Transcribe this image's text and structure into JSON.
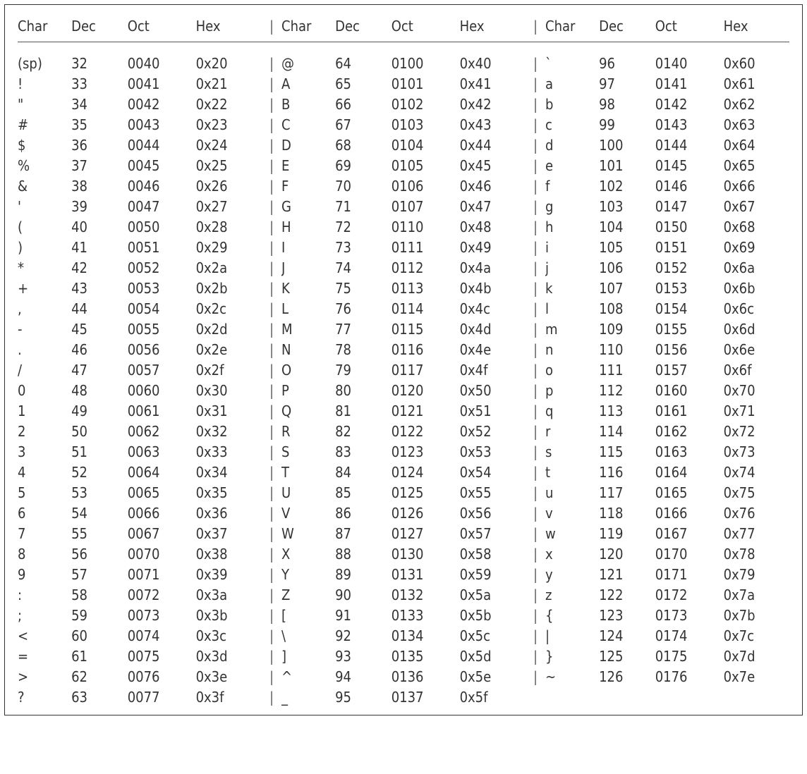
{
  "headers": {
    "char": "Char",
    "dec": "Dec",
    "oct": "Oct",
    "hex": "Hex"
  },
  "separator": "|",
  "columns": [
    [
      {
        "char": "(sp)",
        "dec": "32",
        "oct": "0040",
        "hex": "0x20"
      },
      {
        "char": "!",
        "dec": "33",
        "oct": "0041",
        "hex": "0x21"
      },
      {
        "char": "\"",
        "dec": "34",
        "oct": "0042",
        "hex": "0x22"
      },
      {
        "char": "#",
        "dec": "35",
        "oct": "0043",
        "hex": "0x23"
      },
      {
        "char": "$",
        "dec": "36",
        "oct": "0044",
        "hex": "0x24"
      },
      {
        "char": "%",
        "dec": "37",
        "oct": "0045",
        "hex": "0x25"
      },
      {
        "char": "&",
        "dec": "38",
        "oct": "0046",
        "hex": "0x26"
      },
      {
        "char": "'",
        "dec": "39",
        "oct": "0047",
        "hex": "0x27"
      },
      {
        "char": "(",
        "dec": "40",
        "oct": "0050",
        "hex": "0x28"
      },
      {
        "char": ")",
        "dec": "41",
        "oct": "0051",
        "hex": "0x29"
      },
      {
        "char": "*",
        "dec": "42",
        "oct": "0052",
        "hex": "0x2a"
      },
      {
        "char": "+",
        "dec": "43",
        "oct": "0053",
        "hex": "0x2b"
      },
      {
        "char": ",",
        "dec": "44",
        "oct": "0054",
        "hex": "0x2c"
      },
      {
        "char": "-",
        "dec": "45",
        "oct": "0055",
        "hex": "0x2d"
      },
      {
        "char": ".",
        "dec": "46",
        "oct": "0056",
        "hex": "0x2e"
      },
      {
        "char": "/",
        "dec": "47",
        "oct": "0057",
        "hex": "0x2f"
      },
      {
        "char": "0",
        "dec": "48",
        "oct": "0060",
        "hex": "0x30"
      },
      {
        "char": "1",
        "dec": "49",
        "oct": "0061",
        "hex": "0x31"
      },
      {
        "char": "2",
        "dec": "50",
        "oct": "0062",
        "hex": "0x32"
      },
      {
        "char": "3",
        "dec": "51",
        "oct": "0063",
        "hex": "0x33"
      },
      {
        "char": "4",
        "dec": "52",
        "oct": "0064",
        "hex": "0x34"
      },
      {
        "char": "5",
        "dec": "53",
        "oct": "0065",
        "hex": "0x35"
      },
      {
        "char": "6",
        "dec": "54",
        "oct": "0066",
        "hex": "0x36"
      },
      {
        "char": "7",
        "dec": "55",
        "oct": "0067",
        "hex": "0x37"
      },
      {
        "char": "8",
        "dec": "56",
        "oct": "0070",
        "hex": "0x38"
      },
      {
        "char": "9",
        "dec": "57",
        "oct": "0071",
        "hex": "0x39"
      },
      {
        "char": ":",
        "dec": "58",
        "oct": "0072",
        "hex": "0x3a"
      },
      {
        "char": ";",
        "dec": "59",
        "oct": "0073",
        "hex": "0x3b"
      },
      {
        "char": "<",
        "dec": "60",
        "oct": "0074",
        "hex": "0x3c"
      },
      {
        "char": "=",
        "dec": "61",
        "oct": "0075",
        "hex": "0x3d"
      },
      {
        "char": ">",
        "dec": "62",
        "oct": "0076",
        "hex": "0x3e"
      },
      {
        "char": "?",
        "dec": "63",
        "oct": "0077",
        "hex": "0x3f"
      }
    ],
    [
      {
        "char": "@",
        "dec": "64",
        "oct": "0100",
        "hex": "0x40"
      },
      {
        "char": "A",
        "dec": "65",
        "oct": "0101",
        "hex": "0x41"
      },
      {
        "char": "B",
        "dec": "66",
        "oct": "0102",
        "hex": "0x42"
      },
      {
        "char": "C",
        "dec": "67",
        "oct": "0103",
        "hex": "0x43"
      },
      {
        "char": "D",
        "dec": "68",
        "oct": "0104",
        "hex": "0x44"
      },
      {
        "char": "E",
        "dec": "69",
        "oct": "0105",
        "hex": "0x45"
      },
      {
        "char": "F",
        "dec": "70",
        "oct": "0106",
        "hex": "0x46"
      },
      {
        "char": "G",
        "dec": "71",
        "oct": "0107",
        "hex": "0x47"
      },
      {
        "char": "H",
        "dec": "72",
        "oct": "0110",
        "hex": "0x48"
      },
      {
        "char": "I",
        "dec": "73",
        "oct": "0111",
        "hex": "0x49"
      },
      {
        "char": "J",
        "dec": "74",
        "oct": "0112",
        "hex": "0x4a"
      },
      {
        "char": "K",
        "dec": "75",
        "oct": "0113",
        "hex": "0x4b"
      },
      {
        "char": "L",
        "dec": "76",
        "oct": "0114",
        "hex": "0x4c"
      },
      {
        "char": "M",
        "dec": "77",
        "oct": "0115",
        "hex": "0x4d"
      },
      {
        "char": "N",
        "dec": "78",
        "oct": "0116",
        "hex": "0x4e"
      },
      {
        "char": "O",
        "dec": "79",
        "oct": "0117",
        "hex": "0x4f"
      },
      {
        "char": "P",
        "dec": "80",
        "oct": "0120",
        "hex": "0x50"
      },
      {
        "char": "Q",
        "dec": "81",
        "oct": "0121",
        "hex": "0x51"
      },
      {
        "char": "R",
        "dec": "82",
        "oct": "0122",
        "hex": "0x52"
      },
      {
        "char": "S",
        "dec": "83",
        "oct": "0123",
        "hex": "0x53"
      },
      {
        "char": "T",
        "dec": "84",
        "oct": "0124",
        "hex": "0x54"
      },
      {
        "char": "U",
        "dec": "85",
        "oct": "0125",
        "hex": "0x55"
      },
      {
        "char": "V",
        "dec": "86",
        "oct": "0126",
        "hex": "0x56"
      },
      {
        "char": "W",
        "dec": "87",
        "oct": "0127",
        "hex": "0x57"
      },
      {
        "char": "X",
        "dec": "88",
        "oct": "0130",
        "hex": "0x58"
      },
      {
        "char": "Y",
        "dec": "89",
        "oct": "0131",
        "hex": "0x59"
      },
      {
        "char": "Z",
        "dec": "90",
        "oct": "0132",
        "hex": "0x5a"
      },
      {
        "char": "[",
        "dec": "91",
        "oct": "0133",
        "hex": "0x5b"
      },
      {
        "char": "\\",
        "dec": "92",
        "oct": "0134",
        "hex": "0x5c"
      },
      {
        "char": "]",
        "dec": "93",
        "oct": "0135",
        "hex": "0x5d"
      },
      {
        "char": "^",
        "dec": "94",
        "oct": "0136",
        "hex": "0x5e"
      },
      {
        "char": "_",
        "dec": "95",
        "oct": "0137",
        "hex": "0x5f"
      }
    ],
    [
      {
        "char": "`",
        "dec": "96",
        "oct": "0140",
        "hex": "0x60"
      },
      {
        "char": "a",
        "dec": "97",
        "oct": "0141",
        "hex": "0x61"
      },
      {
        "char": "b",
        "dec": "98",
        "oct": "0142",
        "hex": "0x62"
      },
      {
        "char": "c",
        "dec": "99",
        "oct": "0143",
        "hex": "0x63"
      },
      {
        "char": "d",
        "dec": "100",
        "oct": "0144",
        "hex": "0x64"
      },
      {
        "char": "e",
        "dec": "101",
        "oct": "0145",
        "hex": "0x65"
      },
      {
        "char": "f",
        "dec": "102",
        "oct": "0146",
        "hex": "0x66"
      },
      {
        "char": "g",
        "dec": "103",
        "oct": "0147",
        "hex": "0x67"
      },
      {
        "char": "h",
        "dec": "104",
        "oct": "0150",
        "hex": "0x68"
      },
      {
        "char": "i",
        "dec": "105",
        "oct": "0151",
        "hex": "0x69"
      },
      {
        "char": "j",
        "dec": "106",
        "oct": "0152",
        "hex": "0x6a"
      },
      {
        "char": "k",
        "dec": "107",
        "oct": "0153",
        "hex": "0x6b"
      },
      {
        "char": "l",
        "dec": "108",
        "oct": "0154",
        "hex": "0x6c"
      },
      {
        "char": "m",
        "dec": "109",
        "oct": "0155",
        "hex": "0x6d"
      },
      {
        "char": "n",
        "dec": "110",
        "oct": "0156",
        "hex": "0x6e"
      },
      {
        "char": "o",
        "dec": "111",
        "oct": "0157",
        "hex": "0x6f"
      },
      {
        "char": "p",
        "dec": "112",
        "oct": "0160",
        "hex": "0x70"
      },
      {
        "char": "q",
        "dec": "113",
        "oct": "0161",
        "hex": "0x71"
      },
      {
        "char": "r",
        "dec": "114",
        "oct": "0162",
        "hex": "0x72"
      },
      {
        "char": "s",
        "dec": "115",
        "oct": "0163",
        "hex": "0x73"
      },
      {
        "char": "t",
        "dec": "116",
        "oct": "0164",
        "hex": "0x74"
      },
      {
        "char": "u",
        "dec": "117",
        "oct": "0165",
        "hex": "0x75"
      },
      {
        "char": "v",
        "dec": "118",
        "oct": "0166",
        "hex": "0x76"
      },
      {
        "char": "w",
        "dec": "119",
        "oct": "0167",
        "hex": "0x77"
      },
      {
        "char": "x",
        "dec": "120",
        "oct": "0170",
        "hex": "0x78"
      },
      {
        "char": "y",
        "dec": "121",
        "oct": "0171",
        "hex": "0x79"
      },
      {
        "char": "z",
        "dec": "122",
        "oct": "0172",
        "hex": "0x7a"
      },
      {
        "char": "{",
        "dec": "123",
        "oct": "0173",
        "hex": "0x7b"
      },
      {
        "char": "|",
        "dec": "124",
        "oct": "0174",
        "hex": "0x7c"
      },
      {
        "char": "}",
        "dec": "125",
        "oct": "0175",
        "hex": "0x7d"
      },
      {
        "char": "~",
        "dec": "126",
        "oct": "0176",
        "hex": "0x7e"
      }
    ]
  ]
}
